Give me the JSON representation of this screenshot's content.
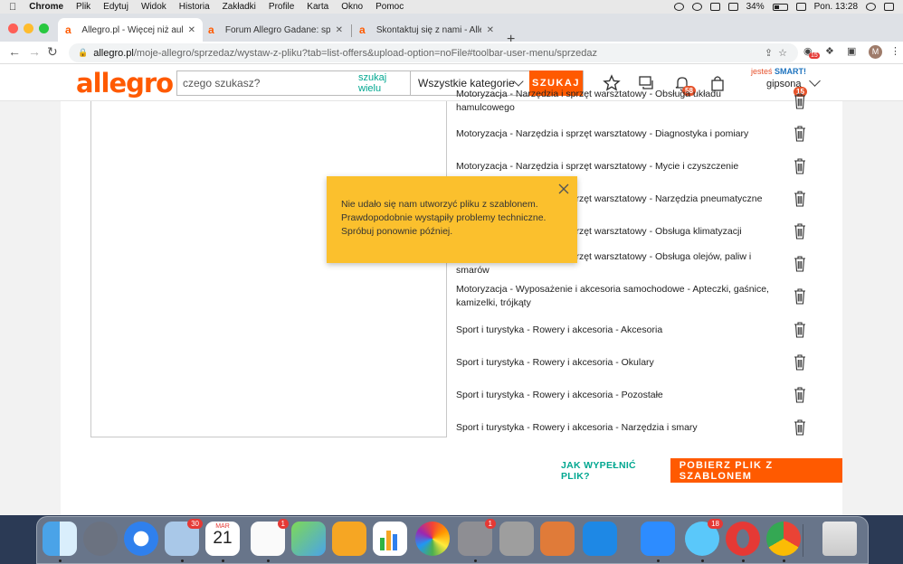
{
  "menubar": {
    "app": "Chrome",
    "items": [
      "Plik",
      "Edytuj",
      "Widok",
      "Historia",
      "Zakładki",
      "Profile",
      "Karta",
      "Okno",
      "Pomoc"
    ],
    "battery": "34%",
    "clock": "Pon. 13:28"
  },
  "tabs": [
    {
      "title": "Allegro.pl - Więcej niż aukcje. N",
      "close": "✕"
    },
    {
      "title": "Forum Allegro Gadane: społeczn",
      "close": "✕"
    },
    {
      "title": "Skontaktuj się z nami - Allegro",
      "close": "✕"
    }
  ],
  "address": {
    "host": "allegro.pl",
    "path": "/moje-allegro/sprzedaz/wystaw-z-pliku?tab=list-offers&upload-option=noFile#toolbar-user-menu/sprzedaz"
  },
  "toolbar_ext_badge": "15",
  "profile_initial": "M",
  "header": {
    "logo": "allegro",
    "search_placeholder": "czego szukasz?",
    "search_multi": "szukaj wielu",
    "category": "Wszystkie kategorie",
    "search_button": "SZUKAJ",
    "notif_badge": "58",
    "smart_prefix": "jesteś",
    "smart_label": "SMART!",
    "username": "gipsona",
    "user_badge": "15"
  },
  "categories": [
    "Motoryzacja - Narzędzia i sprzęt warsztatowy - Obsługa układu hamulcowego",
    "Motoryzacja - Narzędzia i sprzęt warsztatowy - Diagnostyka i pomiary",
    "Motoryzacja - Narzędzia i sprzęt warsztatowy - Mycie i czyszczenie",
    "Motoryzacja - Narzędzia i sprzęt warsztatowy - Narzędzia pneumatyczne",
    "Motoryzacja - Narzędzia i sprzęt warsztatowy - Obsługa klimatyzacji",
    "Motoryzacja - Narzędzia i sprzęt warsztatowy - Obsługa olejów, paliw i smarów",
    "Motoryzacja - Wyposażenie i akcesoria samochodowe - Apteczki, gaśnice, kamizelki, trójkąty",
    "Sport i turystyka - Rowery i akcesoria - Akcesoria",
    "Sport i turystyka - Rowery i akcesoria - Okulary",
    "Sport i turystyka - Rowery i akcesoria - Pozostałe",
    "Sport i turystyka - Rowery i akcesoria - Narzędzia i smary"
  ],
  "actions": {
    "help_link": "JAK WYPEŁNIĆ PLIK?",
    "download": "POBIERZ PLIK Z SZABLONEM"
  },
  "toast": {
    "message": "Nie udało się nam utworzyć pliku z szablonem. Prawdopodobnie wystąpiły problemy techniczne. Spróbuj ponownie później."
  },
  "dock": {
    "mail_badge": "30",
    "calendar_month": "MAR",
    "calendar_day": "21",
    "reminders_badge": "1",
    "prefs_badge": "1",
    "messages_badge": "18"
  },
  "colors": {
    "brand": "#ff5a00",
    "teal": "#00a790",
    "toast": "#fbc02d"
  }
}
